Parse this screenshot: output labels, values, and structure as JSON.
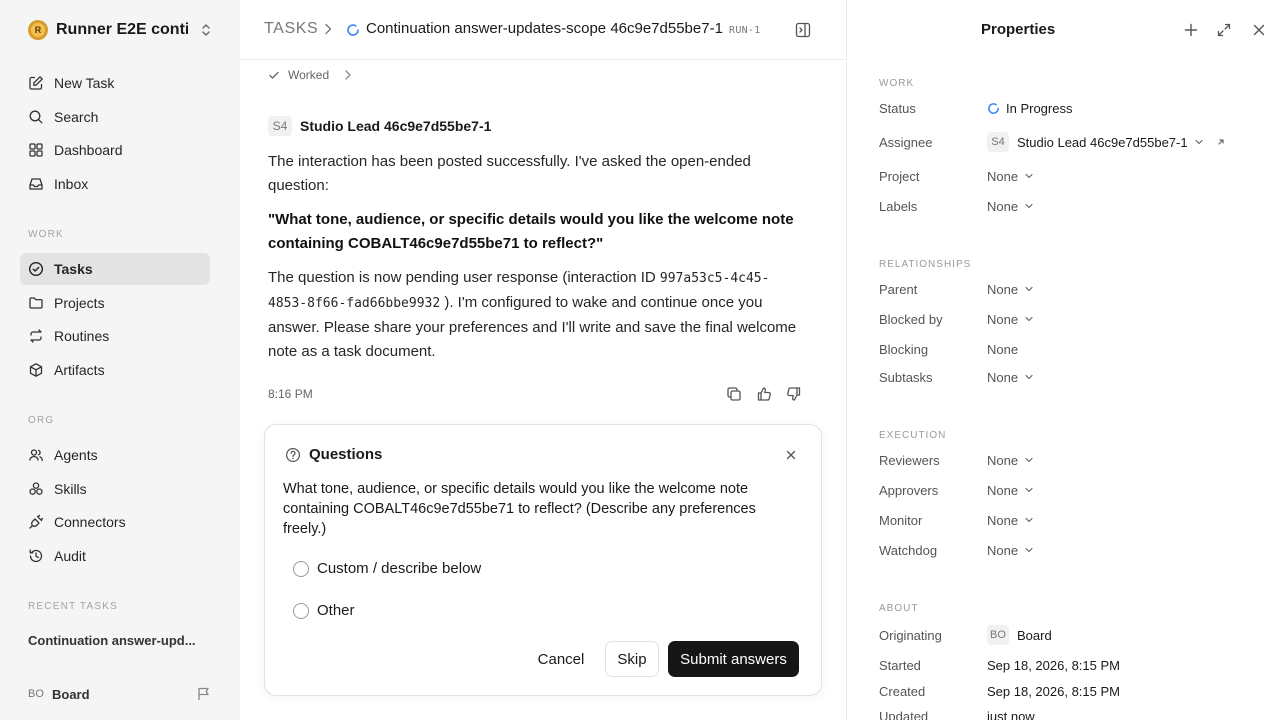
{
  "sidebar": {
    "workspace": {
      "logo": "R",
      "name": "Runner E2E conti..."
    },
    "nav_top": [
      {
        "label": "New Task",
        "icon": "edit-icon"
      },
      {
        "label": "Search",
        "icon": "search-icon"
      },
      {
        "label": "Dashboard",
        "icon": "grid-icon"
      },
      {
        "label": "Inbox",
        "icon": "inbox-icon"
      }
    ],
    "work_label": "WORK",
    "nav_work": [
      {
        "label": "Tasks",
        "icon": "check-circle-icon",
        "active": true
      },
      {
        "label": "Projects",
        "icon": "folder-icon"
      },
      {
        "label": "Routines",
        "icon": "repeat-icon"
      },
      {
        "label": "Artifacts",
        "icon": "box-icon"
      }
    ],
    "org_label": "ORG",
    "nav_org": [
      {
        "label": "Agents",
        "icon": "users-icon"
      },
      {
        "label": "Skills",
        "icon": "skills-icon"
      },
      {
        "label": "Connectors",
        "icon": "plug-icon"
      },
      {
        "label": "Audit",
        "icon": "history-icon"
      }
    ],
    "recent_label": "RECENT TASKS",
    "recent_item": "Continuation answer-upd...",
    "user": {
      "initials": "BO",
      "name": "Board"
    }
  },
  "header": {
    "root": "TASKS",
    "title": "Continuation answer-updates-scope 46c9e7d55be7-1",
    "run_id": "RUN-1"
  },
  "worked_label": "Worked",
  "message": {
    "author_initials": "S4",
    "author": "Studio Lead 46c9e7d55be7-1",
    "p1": "The interaction has been posted successfully. I've asked the open-ended question:",
    "quote": "\"What tone, audience, or specific details would you like the welcome note containing COBALT46c9e7d55be71 to reflect?\"",
    "p3_pre": "The question is now pending user response (interaction ID ",
    "p3_code": "997a53c5-4c45-4853-8f66-fad66bbe9932",
    "p3_post": " ). I'm configured to wake and continue once you answer. Please share your preferences and I'll write and save the final welcome note as a task document.",
    "time": "8:16 PM"
  },
  "questions": {
    "title": "Questions",
    "text": "What tone, audience, or specific details would you like the welcome note containing COBALT46c9e7d55be71 to reflect? (Describe any preferences freely.)",
    "options": [
      "Custom / describe below",
      "Other"
    ],
    "cancel": "Cancel",
    "skip": "Skip",
    "submit": "Submit answers"
  },
  "properties": {
    "title": "Properties",
    "work_label": "WORK",
    "status_key": "Status",
    "status_val": "In Progress",
    "assignee_key": "Assignee",
    "assignee_initials": "S4",
    "assignee_val": "Studio Lead 46c9e7d55be7-1",
    "project_key": "Project",
    "project_val": "None",
    "labels_key": "Labels",
    "labels_val": "None",
    "rel_label": "RELATIONSHIPS",
    "parent_key": "Parent",
    "parent_val": "None",
    "blockedby_key": "Blocked by",
    "blockedby_val": "None",
    "blocking_key": "Blocking",
    "blocking_val": "None",
    "subtasks_key": "Subtasks",
    "subtasks_val": "None",
    "exec_label": "EXECUTION",
    "reviewers_key": "Reviewers",
    "reviewers_val": "None",
    "approvers_key": "Approvers",
    "approvers_val": "None",
    "monitor_key": "Monitor",
    "monitor_val": "None",
    "watchdog_key": "Watchdog",
    "watchdog_val": "None",
    "about_label": "ABOUT",
    "orig_key": "Originating",
    "orig_initials": "BO",
    "orig_val": "Board",
    "started_key": "Started",
    "started_val": "Sep 18, 2026, 8:15 PM",
    "created_key": "Created",
    "created_val": "Sep 18, 2026, 8:15 PM",
    "updated_key": "Updated",
    "updated_val": "just now"
  },
  "colors": {
    "accent_status": "#3b82f6",
    "primary_button": "#161616",
    "sidebar_bg": "#f5f5f5"
  }
}
